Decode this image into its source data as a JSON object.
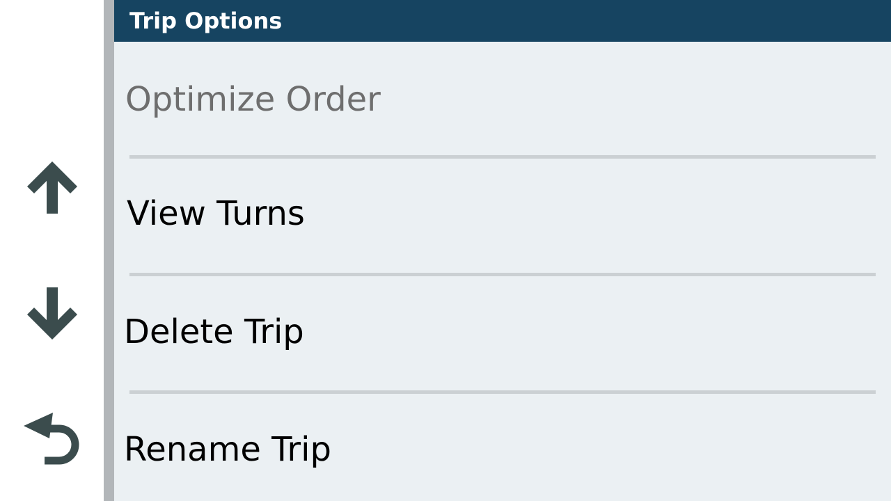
{
  "header": {
    "title": "Trip Options"
  },
  "side_nav": {
    "buttons": [
      {
        "icon": "arrow-up-icon",
        "label": "Scroll Up"
      },
      {
        "icon": "arrow-down-icon",
        "label": "Scroll Down"
      },
      {
        "icon": "back-icon",
        "label": "Back"
      }
    ],
    "icon_color": "#3b4c4d"
  },
  "menu": {
    "items": [
      {
        "label": "Optimize Order",
        "enabled": false
      },
      {
        "label": "View Turns",
        "enabled": true
      },
      {
        "label": "Delete Trip",
        "enabled": true
      },
      {
        "label": "Rename Trip",
        "enabled": true
      }
    ]
  },
  "colors": {
    "header_bg": "#164461",
    "list_bg": "#ebf0f3",
    "divider": "#cbd0d3",
    "side_bar": "#b2b6b9",
    "disabled_text": "#6e6e6e"
  }
}
